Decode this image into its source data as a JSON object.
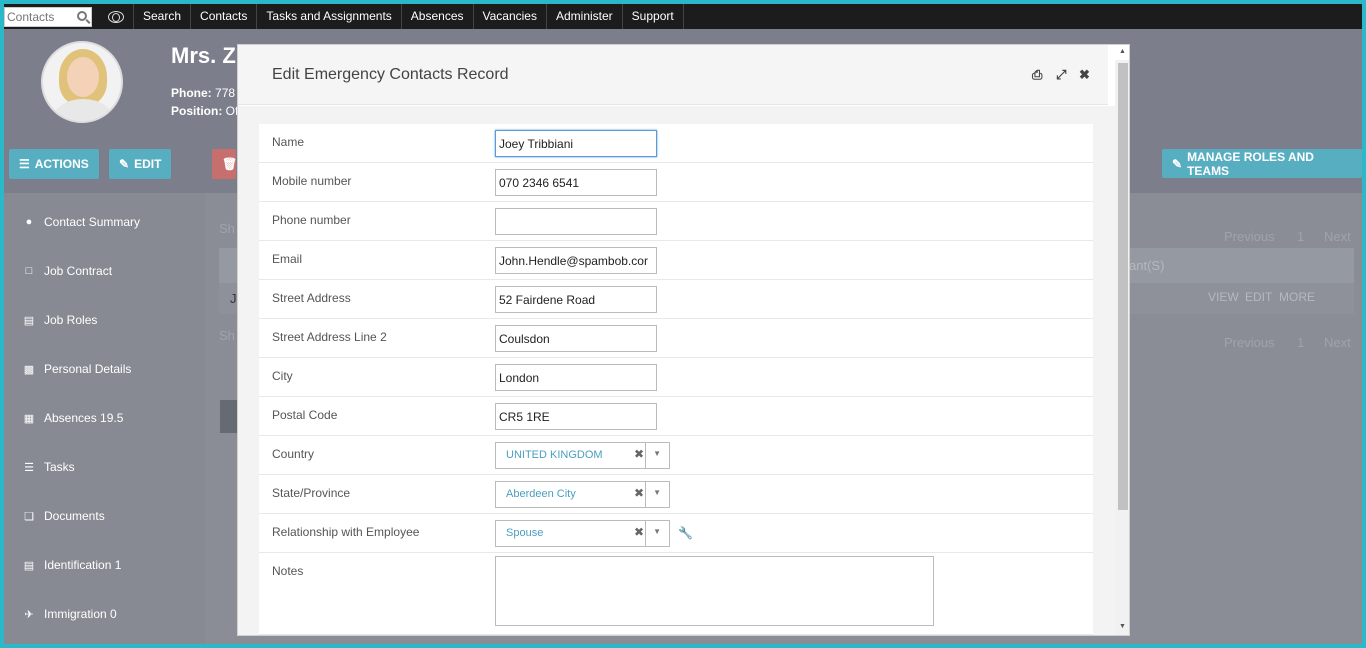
{
  "topnav": {
    "search_placeholder": "Contacts",
    "items": [
      "Search",
      "Contacts",
      "Tasks and Assignments",
      "Absences",
      "Vacancies",
      "Administer",
      "Support"
    ]
  },
  "profile": {
    "name": "Mrs. Z",
    "phone_label": "Phone:",
    "phone_value": "778",
    "position_label": "Position:",
    "position_value": "Of"
  },
  "actionbar": {
    "actions_label": "ACTIONS",
    "edit_label": "EDIT",
    "manage_label": "MANAGE ROLES AND TEAMS"
  },
  "sidebar": {
    "items": [
      {
        "label": "Contact Summary",
        "icon": "person-icon"
      },
      {
        "label": "Job Contract",
        "icon": "document-icon"
      },
      {
        "label": "Job Roles",
        "icon": "id-card-icon"
      },
      {
        "label": "Personal Details",
        "icon": "sitemap-icon"
      },
      {
        "label": "Absences 19.5",
        "icon": "calendar-icon"
      },
      {
        "label": "Tasks",
        "icon": "list-icon"
      },
      {
        "label": "Documents",
        "icon": "documents-icon"
      },
      {
        "label": "Identification 1",
        "icon": "card-icon"
      },
      {
        "label": "Immigration 0",
        "icon": "plane-icon"
      }
    ]
  },
  "background": {
    "show_top": "Sh",
    "show_bottom": "Sh",
    "pager_prev": "Previous",
    "pager_page": "1",
    "pager_next": "Next",
    "col_header": "ant(S)",
    "row_view": "VIEW",
    "row_edit": "EDIT",
    "row_more": "MORE",
    "row_first": "J"
  },
  "modal": {
    "title": "Edit Emergency Contacts Record",
    "fields": {
      "name": {
        "label": "Name",
        "value": "Joey Tribbiani"
      },
      "mobile": {
        "label": "Mobile number",
        "value": "070 2346 6541"
      },
      "phone": {
        "label": "Phone number",
        "value": ""
      },
      "email": {
        "label": "Email",
        "value": "John.Hendle@spambob.cor"
      },
      "street": {
        "label": "Street Address",
        "value": "52 Fairdene Road"
      },
      "street2": {
        "label": "Street Address Line 2",
        "value": "Coulsdon"
      },
      "city": {
        "label": "City",
        "value": "London"
      },
      "postal": {
        "label": "Postal Code",
        "value": "CR5 1RE"
      },
      "country": {
        "label": "Country",
        "value": "UNITED KINGDOM"
      },
      "state": {
        "label": "State/Province",
        "value": "Aberdeen City"
      },
      "relationship": {
        "label": "Relationship with Employee",
        "value": "Spouse"
      },
      "notes": {
        "label": "Notes",
        "value": ""
      }
    }
  },
  "colors": {
    "accent": "#58aec1",
    "link": "#4a9fbf",
    "frame": "#2bb9c9"
  }
}
